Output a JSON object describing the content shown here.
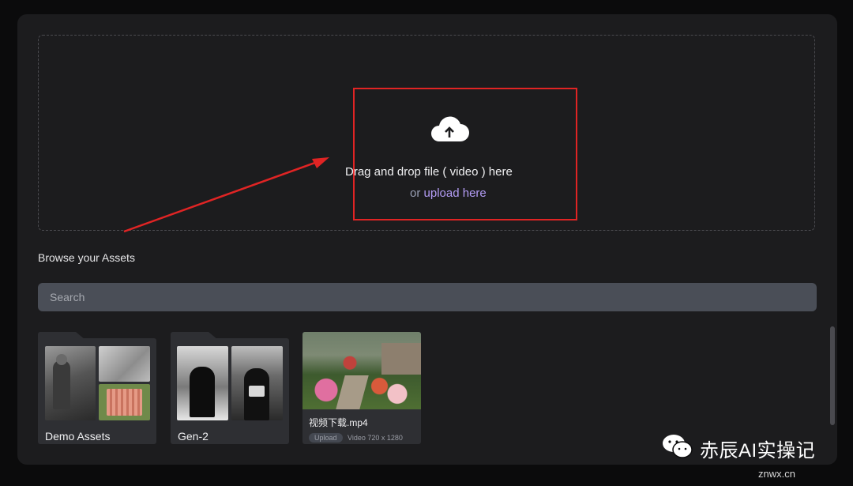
{
  "dropzone": {
    "instruction": "Drag and drop file ( video ) here",
    "or_text": "or",
    "upload_link": "upload here"
  },
  "assets": {
    "title": "Browse your Assets",
    "search_placeholder": "Search",
    "folders": [
      {
        "label": "Demo Assets"
      },
      {
        "label": "Gen-2"
      }
    ],
    "videos": [
      {
        "name": "视频下载.mp4",
        "badge": "Upload",
        "meta": "Video 720 x 1280"
      }
    ]
  },
  "colors": {
    "panel": "#1c1c1e",
    "highlight": "#e02424",
    "link": "#b39cf5",
    "search_bg": "#4a4e57"
  },
  "watermark": {
    "name": "赤辰AI实操记",
    "site": "znwx.cn"
  }
}
